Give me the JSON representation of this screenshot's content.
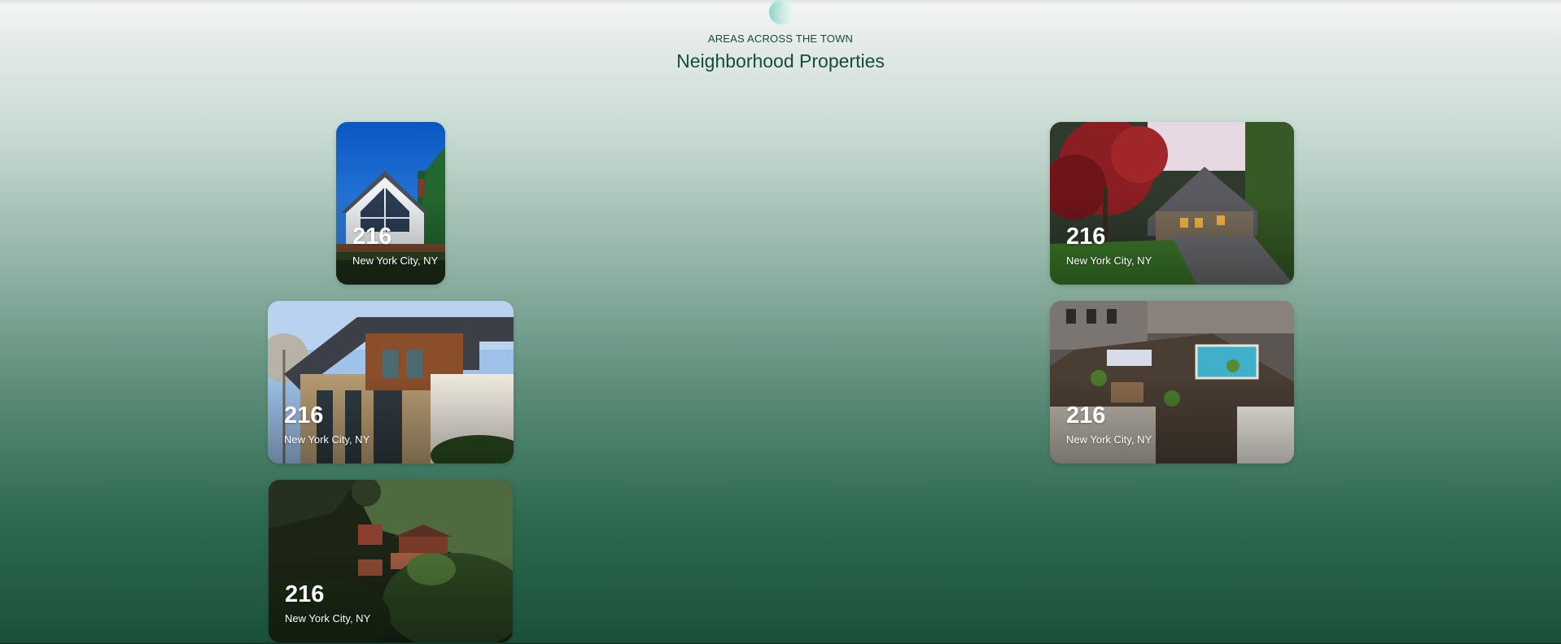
{
  "header": {
    "eyebrow": "AREAS ACROSS THE TOWN",
    "title": "Neighborhood Properties"
  },
  "cards": [
    {
      "count": "216",
      "location": "New York City, NY",
      "image": "white-a-frame-house-blue-sky"
    },
    {
      "count": "216",
      "location": "New York City, NY",
      "image": "craftsman-house-red-maple-driveway"
    },
    {
      "count": "216",
      "location": "New York City, NY",
      "image": "modern-wood-stone-house"
    },
    {
      "count": "216",
      "location": "New York City, NY",
      "image": "rooftop-pool-aerial"
    },
    {
      "count": "216",
      "location": "New York City, NY",
      "image": "chalets-on-forested-hillside"
    }
  ],
  "colors": {
    "title": "#174d36",
    "gradient_top": "#f4f6f5",
    "gradient_bottom": "#1a5039"
  }
}
